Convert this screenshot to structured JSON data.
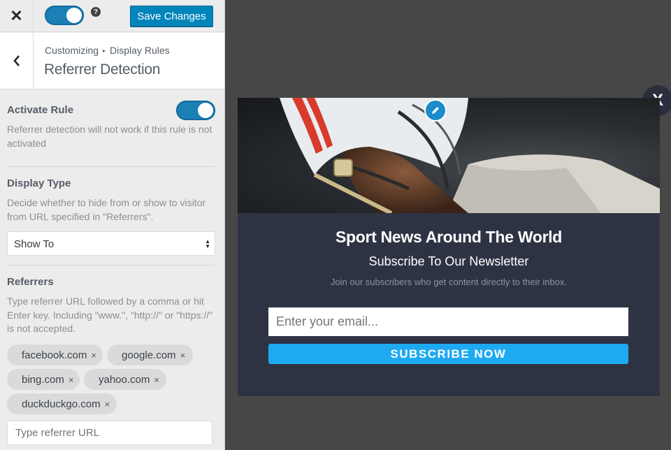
{
  "topbar": {
    "close_icon": "close-icon",
    "toggle_state": "on",
    "help_label": "?",
    "save_label": "Save Changes"
  },
  "section": {
    "breadcrumb_root": "Customizing",
    "breadcrumb_current": "Display Rules",
    "title": "Referrer Detection"
  },
  "activate": {
    "title": "Activate Rule",
    "description": "Referrer detection will not work if this rule is not activated",
    "toggle_state": "on"
  },
  "display_type": {
    "title": "Display Type",
    "description": "Decide whether to hide from or show to visitor from URL specified in \"Referrers\".",
    "selected": "Show To"
  },
  "referrers": {
    "title": "Referrers",
    "description": "Type referrer URL followed by a comma or hit Enter key. Including \"www.\", \"http://\" or \"https://\" is not accepted.",
    "tags": [
      "facebook.com",
      "google.com",
      "bing.com",
      "yahoo.com",
      "duckduckgo.com"
    ],
    "remove_symbol": "×",
    "input_placeholder": "Type referrer URL"
  },
  "popup": {
    "close_label": "X",
    "title": "Sport News Around The World",
    "subtitle": "Subscribe To Our Newsletter",
    "description": "Join our subscribers who get content directly to their inbox.",
    "email_placeholder": "Enter your email...",
    "button_label": "SUBSCRIBE NOW"
  },
  "colors": {
    "accent": "#0085ba",
    "popup_bg": "#2e3344",
    "subscribe": "#1eaaf1"
  }
}
